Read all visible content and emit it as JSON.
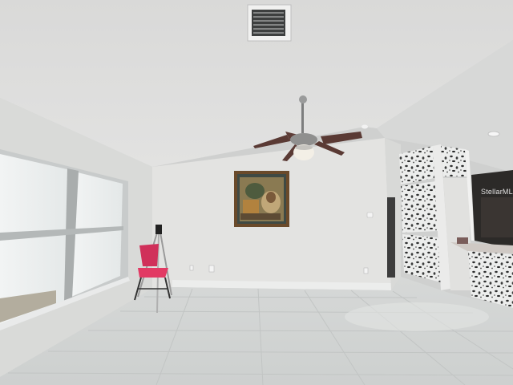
{
  "watermark": {
    "text": "StellarMLS"
  },
  "colors": {
    "ceiling": "#dcdcdb",
    "wall": "#e3e3e1",
    "wall_shadow": "#d3d4d2",
    "floor": "#d7d9d8",
    "grout": "#c4c7c6",
    "window_glass": "#e8ecec",
    "chair_red": "#d0305a",
    "frame_wood": "#6a4a2a",
    "fan_blade": "#5a3a34"
  },
  "icons": {
    "ceiling_vent": "vent-icon",
    "ceiling_fan": "ceiling-fan-icon",
    "outlet": "outlet-icon",
    "recessed_light": "recessed-light-icon"
  }
}
